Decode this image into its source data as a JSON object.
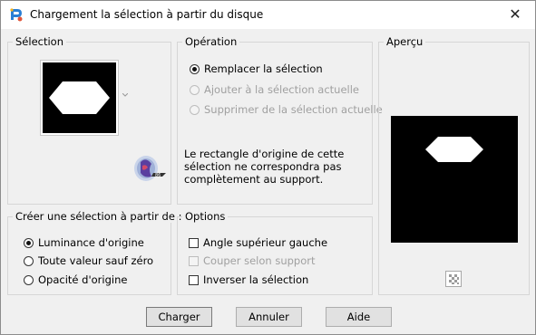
{
  "window": {
    "title": "Chargement la sélection à partir du disque",
    "close_glyph": "✕",
    "app_icon": "paintshop-pro-icon"
  },
  "selection_group": {
    "legend": "Sélection",
    "preview_shape": "hexagon",
    "dropdown_icon": "chevron-down-icon"
  },
  "operation_group": {
    "legend": "Opération",
    "options": [
      {
        "label": "Remplacer la sélection",
        "selected": true,
        "enabled": true
      },
      {
        "label": "Ajouter à la sélection actuelle",
        "selected": false,
        "enabled": false
      },
      {
        "label": "Supprimer de la sélection actuelle",
        "selected": false,
        "enabled": false
      }
    ],
    "info_lines": [
      "Le rectangle d'origine de cette",
      "sélection ne correspondra pas",
      "complètement au support."
    ]
  },
  "apercu_group": {
    "legend": "Aperçu",
    "preview_shape": "hexagon",
    "transparency_icon": "checkerboard-icon"
  },
  "create_group": {
    "legend": "Créer une sélection à partir de :",
    "options": [
      {
        "label": "Luminance d'origine",
        "selected": true
      },
      {
        "label": "Toute valeur sauf zéro",
        "selected": false
      },
      {
        "label": "Opacité d'origine",
        "selected": false
      }
    ]
  },
  "options_group": {
    "legend": "Options",
    "checks": [
      {
        "label": "Angle supérieur gauche",
        "checked": false,
        "enabled": true
      },
      {
        "label": "Couper selon support",
        "checked": false,
        "enabled": false
      },
      {
        "label": "Inverser la sélection",
        "checked": false,
        "enabled": true
      }
    ]
  },
  "buttons": {
    "load": "Charger",
    "cancel": "Annuler",
    "help": "Aide"
  },
  "colors": {
    "dialog_bg": "#f0f0f0",
    "preview_bg": "#000000",
    "shape": "#ffffff"
  }
}
